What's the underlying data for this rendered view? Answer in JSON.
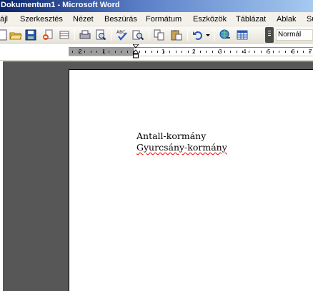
{
  "window": {
    "title": "Dokumentum1 - Microsoft Word"
  },
  "menu": [
    {
      "label": "ájl"
    },
    {
      "label": "Szerkesztés"
    },
    {
      "label": "Nézet"
    },
    {
      "label": "Beszúrás"
    },
    {
      "label": "Formátum"
    },
    {
      "label": "Eszközök"
    },
    {
      "label": "Táblázat"
    },
    {
      "label": "Ablak"
    },
    {
      "label": "Sú"
    }
  ],
  "toolbar": {
    "style_value": "Normál",
    "icons": [
      "new-document-icon",
      "open-folder-icon",
      "save-icon",
      "permission-icon",
      "email-icon",
      "print-icon",
      "print-preview-icon",
      "spelling-icon",
      "research-icon",
      "copy-icon",
      "paste-icon",
      "undo-icon",
      "undo-dropdown-icon",
      "hyperlink-icon",
      "table-icon"
    ]
  },
  "ruler": {
    "labels": [
      "2",
      "1",
      "1",
      "2",
      "3",
      "4",
      "5",
      "6",
      "7"
    ]
  },
  "document": {
    "lines": [
      "Antall-kormány",
      "Gyurcsány-kormány"
    ]
  },
  "colors": {
    "titlebar": "#0a246a",
    "workspace": "#575757",
    "spelling_underline": "#e00"
  }
}
